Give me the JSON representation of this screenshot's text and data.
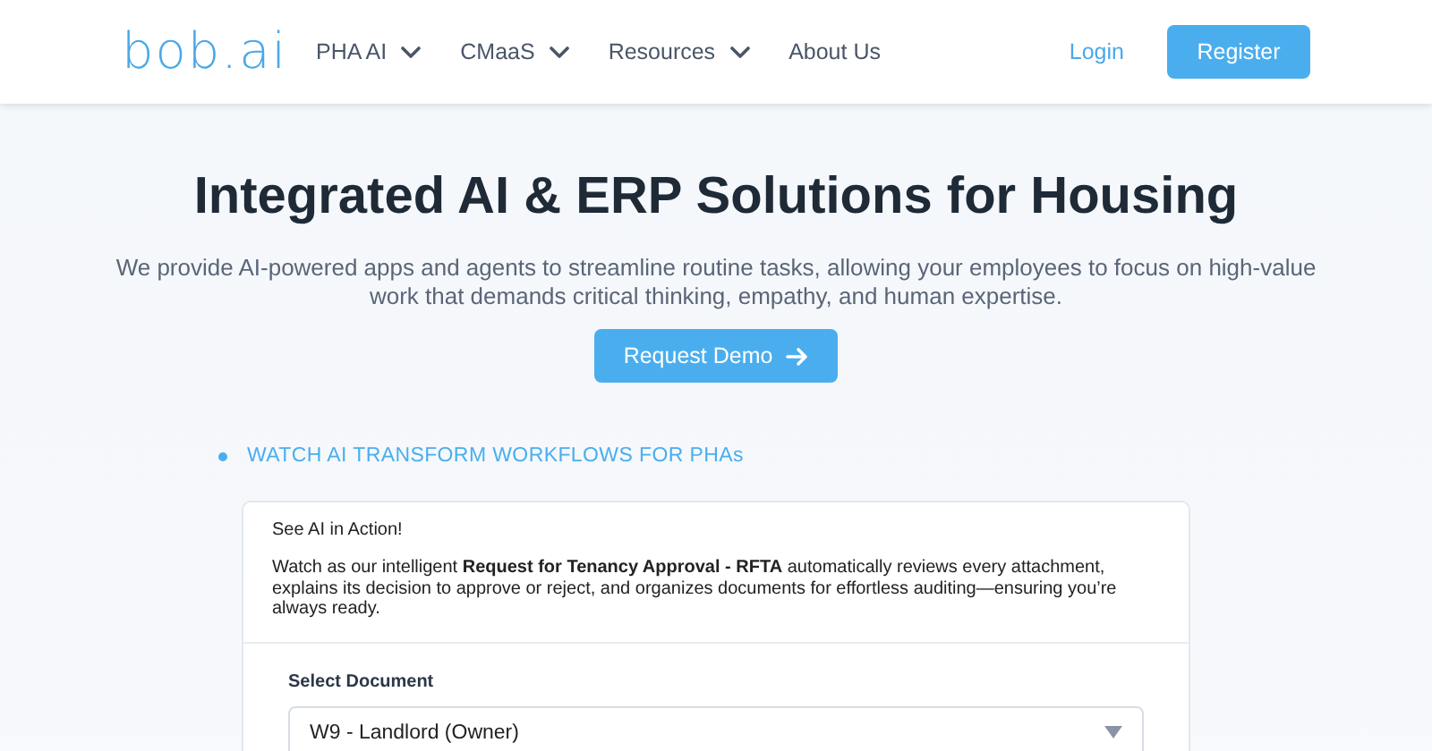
{
  "header": {
    "logo": "bob.ai",
    "nav": [
      {
        "label": "PHA AI",
        "dropdown": true
      },
      {
        "label": "CMaaS",
        "dropdown": true
      },
      {
        "label": "Resources",
        "dropdown": true
      },
      {
        "label": "About Us",
        "dropdown": false
      }
    ],
    "login": "Login",
    "register": "Register"
  },
  "hero": {
    "title": "Integrated AI & ERP Solutions for Housing",
    "subtitle": "We provide AI-powered apps and agents to streamline routine tasks, allowing your employees to focus on high-value work that demands critical thinking, empathy, and human expertise.",
    "cta": "Request Demo"
  },
  "demo": {
    "eyebrow": "WATCH AI TRANSFORM WORKFLOWS FOR PHAs",
    "card_title": "See AI in Action!",
    "card_text": "Watch as our intelligent **Request for Tenancy Approval - RFTA** automatically reviews every attachment, explains its decision to approve or reject, and organizes documents for effortless auditing—ensuring you’re always ready.",
    "select_label": "Select Document",
    "select_value": "W9 - Landlord (Owner)"
  }
}
